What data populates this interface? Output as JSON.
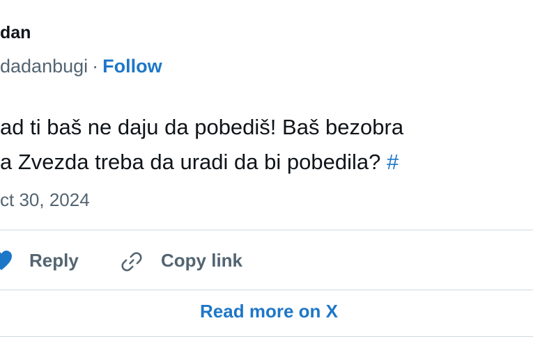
{
  "author": {
    "name": "dan",
    "handle": "dadanbugi",
    "separator": "·",
    "follow_label": "Follow"
  },
  "tweet": {
    "line1": "ad ti baš ne daju da pobediš! Baš bezobra",
    "line2": "a Zvezda treba da uradi da bi pobedila? ",
    "hashtag_fragment": "#",
    "date": "ct 30, 2024"
  },
  "actions": {
    "reply_label": "Reply",
    "copy_link_label": "Copy link"
  },
  "footer": {
    "read_more_label": "Read more on X"
  },
  "colors": {
    "accent": "#1d77c8",
    "text": "#0f1419",
    "muted": "#536471",
    "divider": "#cfd9de",
    "like_red": "#1d77c8"
  },
  "icons": [
    "heart-icon",
    "link-icon"
  ]
}
